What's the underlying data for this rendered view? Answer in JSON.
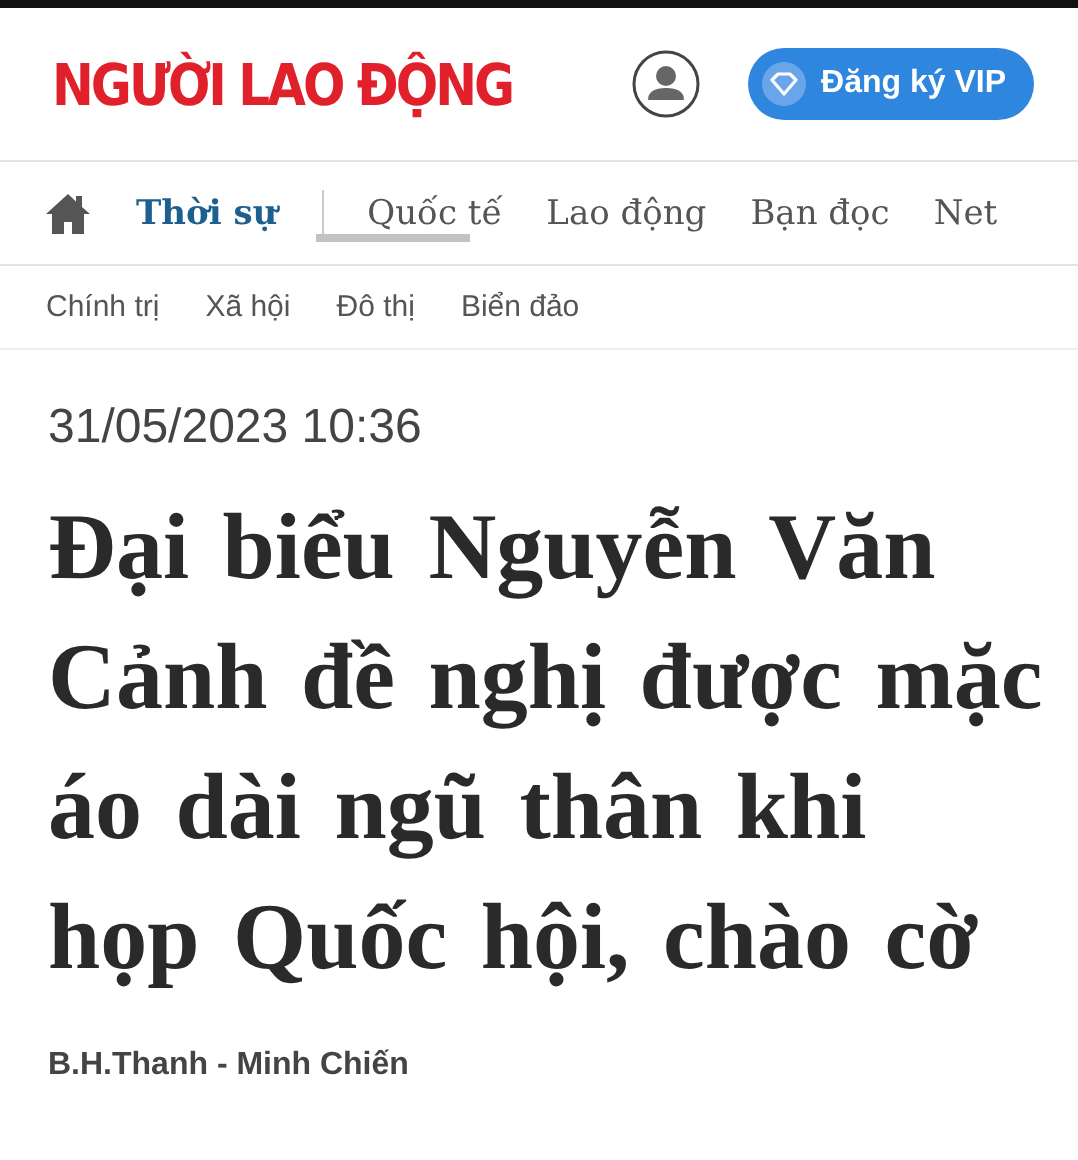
{
  "header": {
    "logo": "NGƯỜI LAO ĐỘNG",
    "vip_button": "Đăng ký VIP"
  },
  "nav": {
    "tabs": [
      {
        "label": "Thời sự",
        "selected": true
      },
      {
        "label": "Quốc tế",
        "selected": false
      },
      {
        "label": "Lao động",
        "selected": false
      },
      {
        "label": "Bạn đọc",
        "selected": false
      },
      {
        "label": "Net",
        "selected": false
      }
    ]
  },
  "subnav": {
    "items": [
      "Chính trị",
      "Xã hội",
      "Đô thị",
      "Biển đảo"
    ]
  },
  "article": {
    "date": "31/05/2023 10:36",
    "title": "Đại biểu Nguyễn Văn Cảnh đề nghị được mặc áo dài ngũ thân khi họp Quốc hội, chào cờ",
    "author": "B.H.Thanh - Minh Chiến"
  }
}
